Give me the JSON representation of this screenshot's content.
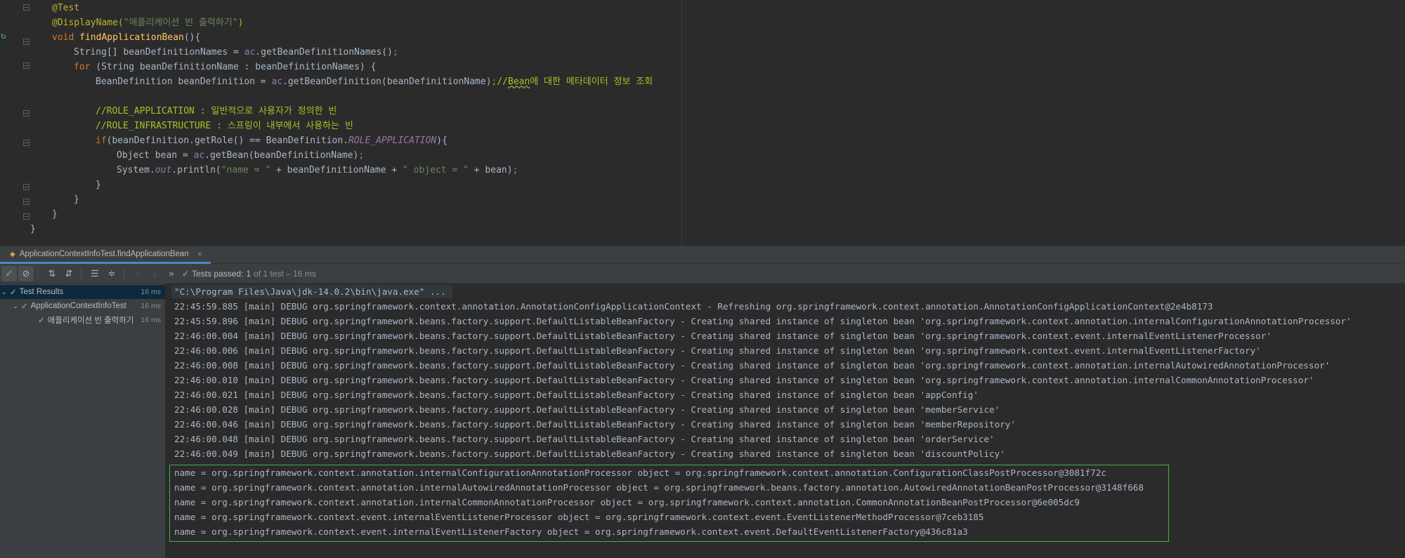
{
  "editor": {
    "lines": [
      {
        "kind": "ann1",
        "text": "@Test"
      },
      {
        "kind": "ann2",
        "prefix": "@DisplayName(",
        "string": "\"애플리케이션 빈 출력하기\"",
        "suffix": ")"
      },
      {
        "kind": "sig",
        "kw": "void",
        "name": "findApplicationBean",
        "rest": "(){"
      },
      {
        "kind": "plain1",
        "t1": "String[] beanDefinitionNames = ",
        "v": "ac",
        "t2": ".getBeanDefinitionNames()",
        "semi": ";"
      },
      {
        "kind": "for",
        "kw": "for",
        "rest": " (String beanDefinitionName : beanDefinitionNames) {"
      },
      {
        "kind": "def",
        "t1": "BeanDefinition beanDefinition = ",
        "v": "ac",
        "t2": ".getBeanDefinition(beanDefinitionName)",
        "semi": ";",
        "comment_pre": "//",
        "comment_sq": "Bean",
        "comment_post": "에 대한 메타데이터 정보 조회"
      },
      {
        "kind": "blank",
        "text": ""
      },
      {
        "kind": "cmt",
        "text": "//ROLE_APPLICATION : 일반적으로 사용자가 정의한 빈"
      },
      {
        "kind": "cmt",
        "text": "//ROLE_INFRASTRUCTURE : 스프링이 내부에서 사용하는 빈"
      },
      {
        "kind": "if",
        "kw": "if",
        "t1": "(beanDefinition.getRole() == BeanDefinition.",
        "fld": "ROLE_APPLICATION",
        "t2": "){"
      },
      {
        "kind": "obj",
        "t1": "Object bean = ",
        "v": "ac",
        "t2": ".getBean(beanDefinitionName)",
        "semi": ";"
      },
      {
        "kind": "print",
        "t1": "System.",
        "fld": "out",
        "t2": ".println(",
        "s1": "\"name = \"",
        "t3": " + beanDefinitionName + ",
        "s2": "\" object = \"",
        "t4": " + bean)",
        "semi": ";"
      },
      {
        "kind": "close",
        "text": "}"
      },
      {
        "kind": "close",
        "text": "}"
      },
      {
        "kind": "close",
        "text": "}"
      },
      {
        "kind": "close",
        "text": "}"
      }
    ]
  },
  "run_tab": {
    "label": "ApplicationContextInfoTest.findApplicationBean",
    "close": "×"
  },
  "toolbar": {
    "status_label": "Tests passed:",
    "status_count": "1",
    "status_detail": "of 1 test – 16 ms"
  },
  "test_tree": [
    {
      "label": "Test Results",
      "time": "16 ms"
    },
    {
      "label": "ApplicationContextInfoTest",
      "time": "16 ms"
    },
    {
      "label": "애플리케이션 빈 출력하기",
      "time": "16 ms"
    }
  ],
  "console": {
    "command": "\"C:\\Program Files\\Java\\jdk-14.0.2\\bin\\java.exe\" ...",
    "log_lines": [
      "22:45:59.885 [main] DEBUG org.springframework.context.annotation.AnnotationConfigApplicationContext - Refreshing org.springframework.context.annotation.AnnotationConfigApplicationContext@2e4b8173",
      "22:45:59.896 [main] DEBUG org.springframework.beans.factory.support.DefaultListableBeanFactory - Creating shared instance of singleton bean 'org.springframework.context.annotation.internalConfigurationAnnotationProcessor'",
      "22:46:00.004 [main] DEBUG org.springframework.beans.factory.support.DefaultListableBeanFactory - Creating shared instance of singleton bean 'org.springframework.context.event.internalEventListenerProcessor'",
      "22:46:00.006 [main] DEBUG org.springframework.beans.factory.support.DefaultListableBeanFactory - Creating shared instance of singleton bean 'org.springframework.context.event.internalEventListenerFactory'",
      "22:46:00.008 [main] DEBUG org.springframework.beans.factory.support.DefaultListableBeanFactory - Creating shared instance of singleton bean 'org.springframework.context.annotation.internalAutowiredAnnotationProcessor'",
      "22:46:00.010 [main] DEBUG org.springframework.beans.factory.support.DefaultListableBeanFactory - Creating shared instance of singleton bean 'org.springframework.context.annotation.internalCommonAnnotationProcessor'",
      "22:46:00.021 [main] DEBUG org.springframework.beans.factory.support.DefaultListableBeanFactory - Creating shared instance of singleton bean 'appConfig'",
      "22:46:00.028 [main] DEBUG org.springframework.beans.factory.support.DefaultListableBeanFactory - Creating shared instance of singleton bean 'memberService'",
      "22:46:00.046 [main] DEBUG org.springframework.beans.factory.support.DefaultListableBeanFactory - Creating shared instance of singleton bean 'memberRepository'",
      "22:46:00.048 [main] DEBUG org.springframework.beans.factory.support.DefaultListableBeanFactory - Creating shared instance of singleton bean 'orderService'",
      "22:46:00.049 [main] DEBUG org.springframework.beans.factory.support.DefaultListableBeanFactory - Creating shared instance of singleton bean 'discountPolicy'"
    ],
    "output_lines": [
      "name = org.springframework.context.annotation.internalConfigurationAnnotationProcessor object = org.springframework.context.annotation.ConfigurationClassPostProcessor@3081f72c",
      "name = org.springframework.context.annotation.internalAutowiredAnnotationProcessor object = org.springframework.beans.factory.annotation.AutowiredAnnotationBeanPostProcessor@3148f668",
      "name = org.springframework.context.annotation.internalCommonAnnotationProcessor object = org.springframework.context.annotation.CommonAnnotationBeanPostProcessor@6e005dc9",
      "name = org.springframework.context.event.internalEventListenerProcessor object = org.springframework.context.event.EventListenerMethodProcessor@7ceb3185",
      "name = org.springframework.context.event.internalEventListenerFactory object = org.springframework.context.event.DefaultEventListenerFactory@436c81a3"
    ]
  },
  "colors": {
    "pass_green": "#59a869",
    "highlight_border": "#3fb04f",
    "selection_blue": "#0d293e",
    "tab_underline": "#4a88c7"
  }
}
